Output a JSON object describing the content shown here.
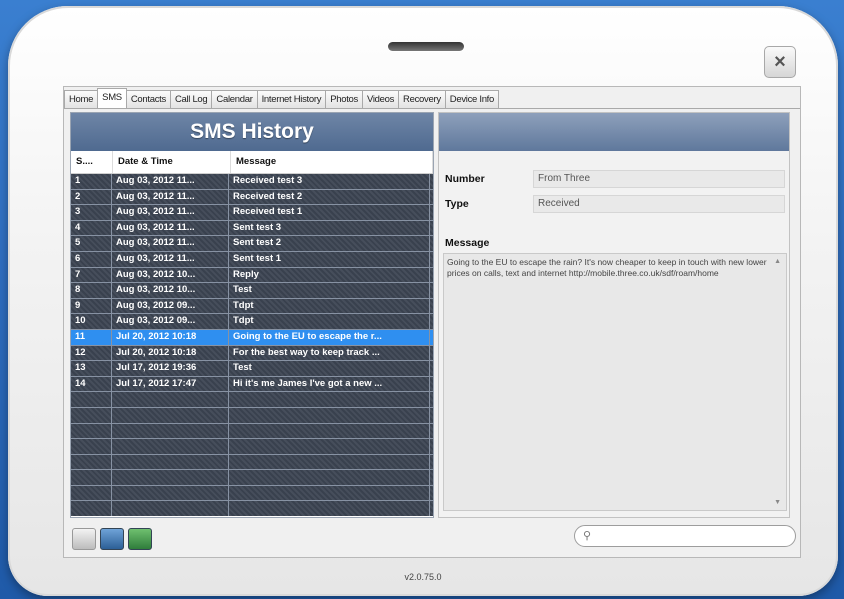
{
  "window": {
    "close_icon": "×"
  },
  "tabs": [
    {
      "label": "Home"
    },
    {
      "label": "SMS",
      "active": true
    },
    {
      "label": "Contacts"
    },
    {
      "label": "Call Log"
    },
    {
      "label": "Calendar"
    },
    {
      "label": "Internet History"
    },
    {
      "label": "Photos"
    },
    {
      "label": "Videos"
    },
    {
      "label": "Recovery"
    },
    {
      "label": "Device Info"
    }
  ],
  "sms_panel": {
    "title": "SMS History",
    "columns": [
      "S....",
      "Date & Time",
      "Message"
    ],
    "rows": [
      [
        "1",
        "Aug 03, 2012 11...",
        "Received test 3"
      ],
      [
        "2",
        "Aug 03, 2012 11...",
        "Received test 2"
      ],
      [
        "3",
        "Aug 03, 2012 11...",
        "Received test 1"
      ],
      [
        "4",
        "Aug 03, 2012 11...",
        "Sent test 3"
      ],
      [
        "5",
        "Aug 03, 2012 11...",
        "Sent test 2"
      ],
      [
        "6",
        "Aug 03, 2012 11...",
        "Sent test 1"
      ],
      [
        "7",
        "Aug 03, 2012 10...",
        "Reply"
      ],
      [
        "8",
        "Aug 03, 2012 10...",
        "Test"
      ],
      [
        "9",
        "Aug 03, 2012 09...",
        "Tdpt"
      ],
      [
        "10",
        "Aug 03, 2012 09...",
        "Tdpt"
      ],
      [
        "11",
        "Jul 20, 2012 10:18",
        "Going to the EU to escape the r..."
      ],
      [
        "12",
        "Jul 20, 2012 10:18",
        "For the best way to keep track ..."
      ],
      [
        "13",
        "Jul 17, 2012 19:36",
        "Test"
      ],
      [
        "14",
        "Jul 17, 2012 17:47",
        "Hi it's me James I've got a new ..."
      ]
    ],
    "selected_index": 10
  },
  "detail": {
    "number_label": "Number",
    "number_value": "From Three",
    "type_label": "Type",
    "type_value": "Received",
    "message_label": "Message",
    "message_text": "Going to the EU to escape the rain? It's now cheaper to keep in touch with new lower prices on calls, text and internet http://mobile.three.co.uk/sdf/roam/home"
  },
  "bottom": {
    "search_placeholder": ""
  },
  "version": "v2.0.75.0",
  "colors": {
    "header": "#5a7396",
    "rows": "#3c4452",
    "selected": "#2f8ff0"
  }
}
